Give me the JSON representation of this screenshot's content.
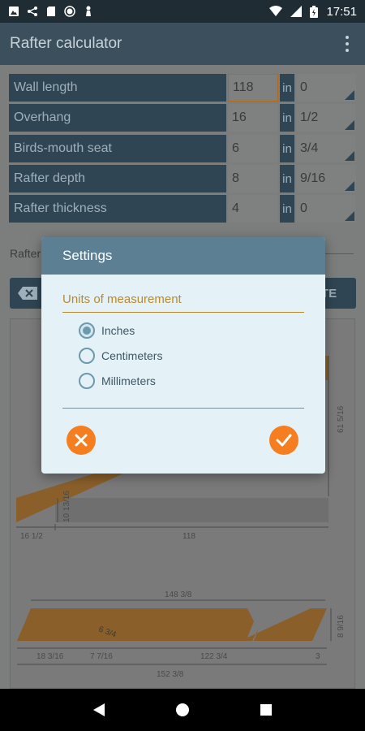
{
  "status_bar": {
    "time": "17:51"
  },
  "app_bar": {
    "title": "Rafter calculator"
  },
  "inputs": [
    {
      "label": "Wall length",
      "value": "118",
      "unit": "in",
      "fraction": "0"
    },
    {
      "label": "Overhang",
      "value": "16",
      "unit": "in",
      "fraction": "1/2"
    },
    {
      "label": "Birds-mouth seat",
      "value": "6",
      "unit": "in",
      "fraction": "3/4"
    },
    {
      "label": "Rafter depth",
      "value": "8",
      "unit": "in",
      "fraction": "9/16"
    },
    {
      "label": "Rafter thickness",
      "value": "4",
      "unit": "in",
      "fraction": "0"
    }
  ],
  "section": {
    "label": "Rafter"
  },
  "background_button": {
    "label_partial": "TE"
  },
  "diagram": {
    "dims_top": {
      "height": "61 5/16",
      "side": "10 13/16",
      "overhang": "16 1/2",
      "run": "118"
    },
    "dims_bottom": {
      "total_top": "148 3/8",
      "angle": "6 3/4",
      "depth": "8 9/16",
      "a": "18 3/16",
      "b": "7 7/16",
      "c": "122 3/4",
      "d": "3",
      "total": "152 3/8"
    }
  },
  "dialog": {
    "title": "Settings",
    "section_label": "Units of measurement",
    "options": [
      {
        "label": "Inches",
        "checked": true
      },
      {
        "label": "Centimeters",
        "checked": false
      },
      {
        "label": "Millimeters",
        "checked": false
      }
    ],
    "cancel_icon": "close-icon",
    "ok_icon": "check-icon"
  },
  "colors": {
    "accent": "#f57f20",
    "header": "#5c7f93",
    "appbar": "#3b4f5c"
  }
}
